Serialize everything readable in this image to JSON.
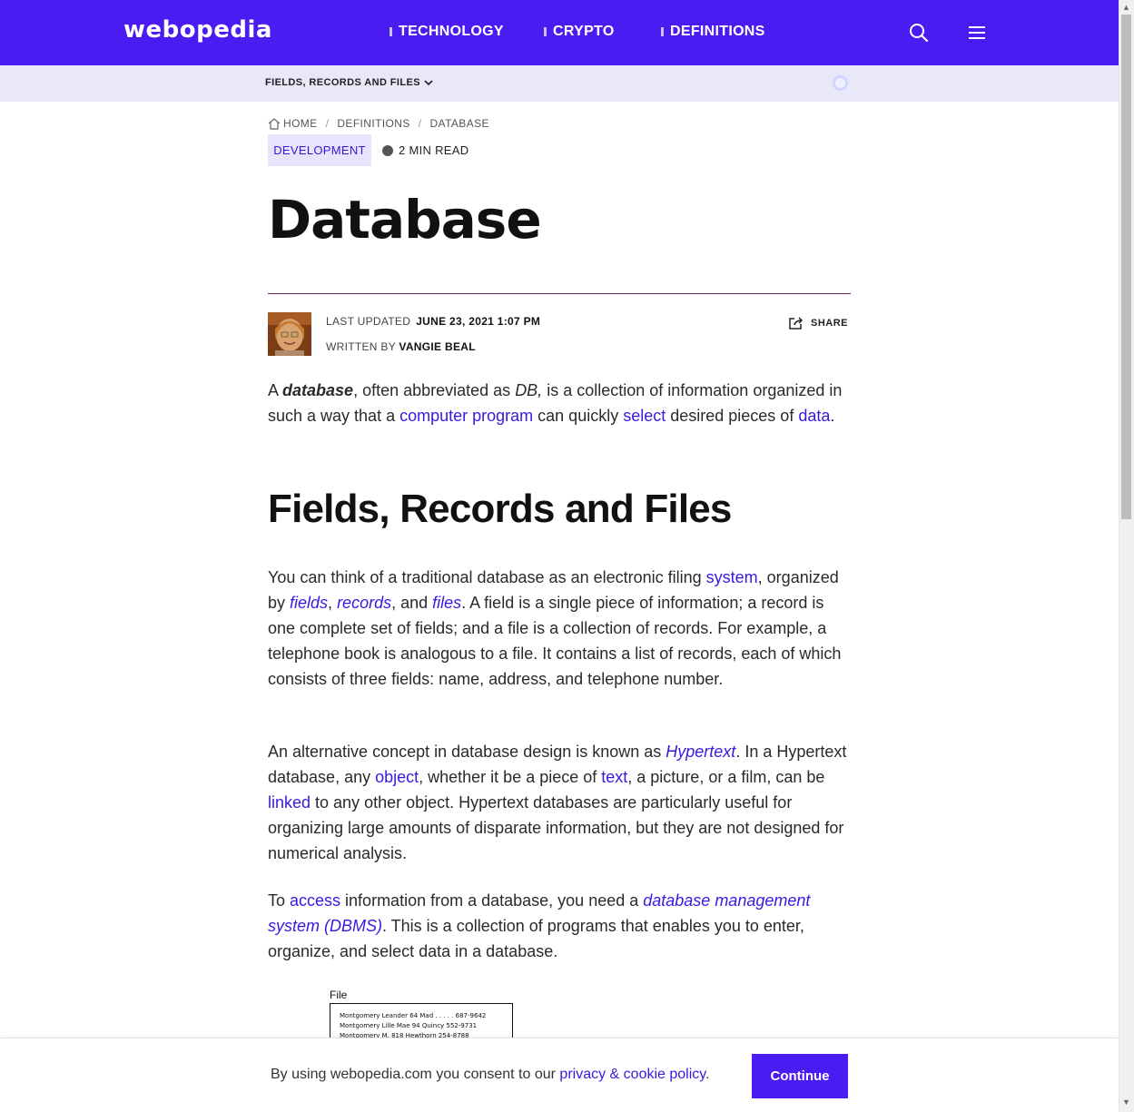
{
  "nav": {
    "logo": "webopedia",
    "links": [
      "TECHNOLOGY",
      "CRYPTO",
      "DEFINITIONS"
    ]
  },
  "subbar": {
    "dropdown_label": "FIELDS, RECORDS AND FILES"
  },
  "breadcrumb": {
    "home": "HOME",
    "definitions": "DEFINITIONS",
    "current": "DATABASE"
  },
  "category": "DEVELOPMENT",
  "read_time": "2 MIN READ",
  "title": "Database",
  "meta": {
    "updated_label": "LAST UPDATED",
    "updated_value": "JUNE 23, 2021 1:07 PM",
    "written_label": "WRITTEN BY",
    "author": "VANGIE BEAL",
    "share_label": "SHARE"
  },
  "intro": {
    "t1": "A ",
    "bold": "database",
    "t2": ", often abbreviated as ",
    "italic": "DB,",
    "t3": " is a collection of information organized in such a way that a ",
    "link1": "computer program",
    "t4": " can quickly ",
    "link2": "select",
    "t5": " desired pieces of ",
    "link3": "data",
    "t6": "."
  },
  "section_heading": "Fields, Records and Files",
  "para2": {
    "t1": "You can think of a traditional database as an electronic filing ",
    "link_system": "system",
    "t2": ", organized by ",
    "link_fields": "fields",
    "c1": ", ",
    "link_records": "records",
    "t3": ", and ",
    "link_files": "files",
    "t4": ". A field is a single piece of information; a record is one complete set of fields; and a file is a collection of records. For example, a telephone book is analogous to a file. It contains a list of records, each of which consists of three fields: name, address, and telephone number."
  },
  "para3": {
    "t1": "An alternative concept in database design is known as ",
    "link_hypertext": "Hypertext",
    "t2": ". In a Hypertext database, any ",
    "link_object": "object",
    "t3": ", whether it be a piece of ",
    "link_text": "text",
    "t4": ", a picture, or a film, can be ",
    "link_linked": "linked",
    "t5": " to any other object. Hypertext databases are particularly useful for organizing large amounts of disparate information, but they are not designed for numerical analysis."
  },
  "para4": {
    "t1": "To ",
    "link_access": "access",
    "t2": " information from a database, you need a ",
    "link_dbms": "database management system (DBMS)",
    "t3": ". This is a collection of programs that enables you to enter, organize, and select data in a database."
  },
  "figure": {
    "label": "File",
    "rows": [
      "Montgomery Leander     64 Mad . . . . .   687-9642",
      "Montgomery Lille Mae       94 Quincy     552-9731",
      "Montgomery M.    818 Hewthorn        254-8788"
    ]
  },
  "cookie": {
    "text": "By using webopedia.com you consent to our ",
    "link": "privacy & cookie policy",
    "end": ".",
    "button": "Continue"
  },
  "colors": {
    "brand": "#4b1cf2",
    "link": "#3b18e0",
    "subbar": "#e8e8f8"
  }
}
